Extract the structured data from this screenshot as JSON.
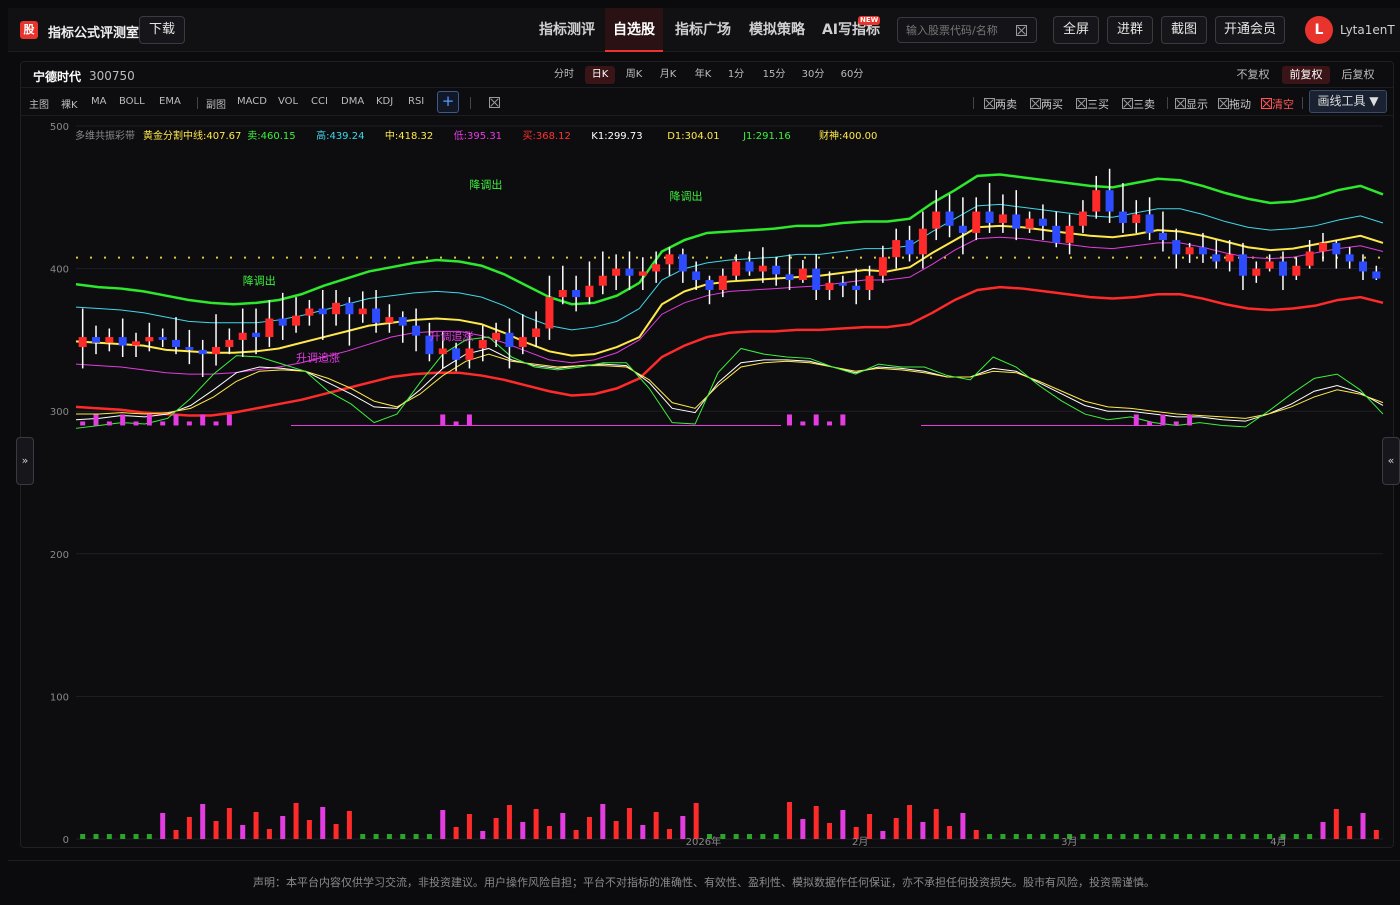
{
  "header": {
    "logo_text": "股",
    "app_title": "指标公式评测室",
    "download_label": "下载",
    "nav": [
      {
        "label": "指标测评"
      },
      {
        "label": "自选股",
        "active": true
      },
      {
        "label": "指标广场"
      },
      {
        "label": "模拟策略"
      },
      {
        "label": "AI写指标",
        "badge": "NEW"
      }
    ],
    "search_placeholder": "输入股票代码/名称",
    "buttons": {
      "fullscreen": "全屏",
      "join_group": "进群",
      "screenshot": "截图",
      "membership": "开通会员"
    },
    "user": {
      "avatar_letter": "L",
      "name": "Lyta1enT"
    }
  },
  "stock": {
    "name": "宁德时代",
    "code": "300750"
  },
  "timeframes": [
    "分时",
    "日K",
    "周K",
    "月K",
    "年K",
    "1分",
    "15分",
    "30分",
    "60分"
  ],
  "active_timeframe": "日K",
  "adjust_options": [
    "不复权",
    "前复权",
    "后复权"
  ],
  "active_adjust": "前复权",
  "indicator_tabs": {
    "main_label": "主图",
    "main": [
      "裸K",
      "MA",
      "BOLL",
      "EMA"
    ],
    "sub_label": "副图",
    "sub": [
      "MACD",
      "VOL",
      "CCI",
      "DMA",
      "KDJ",
      "RSI"
    ],
    "add": "+"
  },
  "toggles": [
    {
      "label": "两卖"
    },
    {
      "label": "两买"
    },
    {
      "label": "三买"
    },
    {
      "label": "三卖"
    },
    {
      "label": "显示"
    },
    {
      "label": "拖动"
    },
    {
      "label": "清空",
      "red": true
    }
  ],
  "draw_tool_label": "画线工具 ▼",
  "chart_data": {
    "type": "candlestick",
    "indicator_name": "多维共振彩带",
    "y_ticks": [
      500,
      400,
      300,
      200,
      100,
      0
    ],
    "ylim": [
      0,
      500
    ],
    "x_labels": [
      "2026年",
      "2月",
      "3月",
      "4月"
    ],
    "legend": [
      {
        "label": "黄金分割中线:407.67",
        "color": "#ffe94a"
      },
      {
        "label": "卖:460.15",
        "color": "#3cf03c"
      },
      {
        "label": "高:439.24",
        "color": "#3fd8e8"
      },
      {
        "label": "中:418.32",
        "color": "#ffe94a"
      },
      {
        "label": "低:395.31",
        "color": "#e33ce0"
      },
      {
        "label": "买:368.12",
        "color": "#ff3030"
      },
      {
        "label": "K1:299.73",
        "color": "#ffffff"
      },
      {
        "label": "D1:304.01",
        "color": "#ffe94a"
      },
      {
        "label": "J1:291.16",
        "color": "#3cf03c"
      },
      {
        "label": "财神:400.00",
        "color": "#ffe94a"
      }
    ],
    "annotations": [
      {
        "label": "降调出",
        "color": "#3cf03c",
        "i": 12,
        "y": 389
      },
      {
        "label": "升调追涨",
        "color": "#e33ce0",
        "i": 16,
        "y": 335
      },
      {
        "label": "升调追涨",
        "color": "#e33ce0",
        "i": 26,
        "y": 350
      },
      {
        "label": "降调出",
        "color": "#3cf03c",
        "i": 29,
        "y": 456
      },
      {
        "label": "降调出",
        "color": "#3cf03c",
        "i": 44,
        "y": 448
      }
    ],
    "golden_line": 407.67,
    "candles": [
      [
        345,
        352,
        330,
        372
      ],
      [
        352,
        348,
        340,
        360
      ],
      [
        348,
        352,
        342,
        358
      ],
      [
        352,
        346,
        338,
        365
      ],
      [
        346,
        349,
        338,
        355
      ],
      [
        349,
        352,
        342,
        362
      ],
      [
        352,
        350,
        345,
        358
      ],
      [
        350,
        345,
        340,
        366
      ],
      [
        345,
        343,
        333,
        357
      ],
      [
        343,
        340,
        324,
        350
      ],
      [
        340,
        345,
        332,
        368
      ],
      [
        345,
        350,
        340,
        358
      ],
      [
        350,
        355,
        338,
        372
      ],
      [
        355,
        352,
        340,
        372
      ],
      [
        352,
        365,
        345,
        378
      ],
      [
        365,
        360,
        350,
        383
      ],
      [
        360,
        367,
        355,
        380
      ],
      [
        367,
        372,
        360,
        378
      ],
      [
        372,
        368,
        350,
        385
      ],
      [
        368,
        376,
        360,
        385
      ],
      [
        376,
        368,
        346,
        380
      ],
      [
        368,
        372,
        362,
        384
      ],
      [
        372,
        362,
        355,
        385
      ],
      [
        362,
        366,
        355,
        375
      ],
      [
        366,
        360,
        348,
        370
      ],
      [
        360,
        353,
        342,
        372
      ],
      [
        353,
        340,
        335,
        362
      ],
      [
        340,
        344,
        330,
        356
      ],
      [
        344,
        336,
        328,
        348
      ],
      [
        336,
        344,
        330,
        355
      ],
      [
        344,
        350,
        335,
        360
      ],
      [
        350,
        355,
        345,
        362
      ],
      [
        355,
        345,
        330,
        365
      ],
      [
        345,
        352,
        340,
        368
      ],
      [
        352,
        358,
        345,
        370
      ],
      [
        358,
        380,
        350,
        395
      ],
      [
        380,
        385,
        375,
        402
      ],
      [
        385,
        380,
        370,
        395
      ],
      [
        380,
        388,
        375,
        405
      ],
      [
        388,
        395,
        382,
        412
      ],
      [
        395,
        400,
        385,
        410
      ],
      [
        400,
        395,
        385,
        412
      ],
      [
        395,
        398,
        385,
        408
      ],
      [
        398,
        403,
        390,
        412
      ],
      [
        403,
        410,
        395,
        415
      ],
      [
        410,
        398,
        390,
        414
      ],
      [
        398,
        392,
        385,
        405
      ],
      [
        392,
        385,
        375,
        395
      ],
      [
        385,
        395,
        380,
        400
      ],
      [
        395,
        405,
        392,
        410
      ],
      [
        405,
        398,
        395,
        412
      ],
      [
        398,
        402,
        390,
        415
      ],
      [
        402,
        396,
        388,
        408
      ],
      [
        396,
        392,
        385,
        410
      ],
      [
        392,
        400,
        390,
        406
      ],
      [
        400,
        385,
        378,
        410
      ],
      [
        385,
        390,
        378,
        398
      ],
      [
        390,
        388,
        380,
        395
      ],
      [
        388,
        385,
        375,
        400
      ],
      [
        385,
        395,
        378,
        402
      ],
      [
        395,
        408,
        390,
        416
      ],
      [
        408,
        420,
        400,
        428
      ],
      [
        420,
        410,
        405,
        430
      ],
      [
        410,
        428,
        400,
        440
      ],
      [
        428,
        440,
        420,
        455
      ],
      [
        440,
        430,
        422,
        452
      ],
      [
        430,
        425,
        410,
        450
      ],
      [
        425,
        440,
        420,
        450
      ],
      [
        440,
        432,
        425,
        460
      ],
      [
        432,
        438,
        425,
        452
      ],
      [
        438,
        428,
        420,
        455
      ],
      [
        428,
        435,
        425,
        440
      ],
      [
        435,
        430,
        420,
        445
      ],
      [
        430,
        418,
        415,
        440
      ],
      [
        418,
        430,
        410,
        438
      ],
      [
        430,
        440,
        425,
        448
      ],
      [
        440,
        455,
        435,
        465
      ],
      [
        455,
        440,
        432,
        470
      ],
      [
        440,
        432,
        425,
        460
      ],
      [
        432,
        438,
        425,
        448
      ],
      [
        438,
        425,
        420,
        450
      ],
      [
        425,
        420,
        412,
        440
      ],
      [
        420,
        410,
        400,
        428
      ],
      [
        410,
        415,
        404,
        418
      ],
      [
        415,
        410,
        404,
        425
      ],
      [
        410,
        405,
        400,
        420
      ],
      [
        405,
        410,
        398,
        420
      ],
      [
        410,
        395,
        385,
        418
      ],
      [
        395,
        400,
        390,
        405
      ],
      [
        400,
        405,
        398,
        410
      ],
      [
        405,
        395,
        385,
        412
      ],
      [
        395,
        402,
        392,
        408
      ],
      [
        402,
        412,
        400,
        420
      ],
      [
        412,
        418,
        405,
        425
      ],
      [
        418,
        410,
        400,
        420
      ],
      [
        410,
        405,
        400,
        415
      ],
      [
        405,
        398,
        392,
        410
      ],
      [
        398,
        393,
        392,
        402
      ]
    ],
    "bands": {
      "sell": [
        389,
        387,
        386,
        384,
        381,
        378,
        376,
        375,
        376,
        378,
        382,
        388,
        393,
        398,
        401,
        404,
        406,
        405,
        402,
        396,
        388,
        380,
        375,
        376,
        381,
        390,
        412,
        420,
        425,
        426,
        427,
        428,
        430,
        430,
        432,
        433,
        433,
        435,
        446,
        455,
        465,
        466,
        464,
        462,
        460,
        458,
        457,
        460,
        463,
        462,
        458,
        453,
        449,
        446,
        447,
        450,
        455,
        458,
        452
      ],
      "high": [
        373,
        372,
        371,
        369,
        366,
        363,
        362,
        362,
        362,
        364,
        367,
        371,
        375,
        379,
        381,
        383,
        384,
        383,
        380,
        374,
        366,
        360,
        357,
        359,
        363,
        372,
        392,
        400,
        404,
        406,
        407,
        408,
        410,
        410,
        412,
        414,
        414,
        416,
        426,
        435,
        444,
        445,
        443,
        441,
        439,
        437,
        436,
        439,
        442,
        442,
        438,
        433,
        429,
        427,
        428,
        430,
        434,
        437,
        432
      ],
      "low": [
        333,
        332,
        331,
        329,
        327,
        326,
        326,
        327,
        329,
        331,
        334,
        338,
        342,
        347,
        352,
        355,
        356,
        356,
        353,
        348,
        342,
        336,
        334,
        336,
        341,
        350,
        368,
        376,
        381,
        384,
        385,
        386,
        387,
        388,
        390,
        392,
        392,
        394,
        403,
        413,
        421,
        422,
        421,
        419,
        417,
        415,
        414,
        416,
        418,
        418,
        415,
        411,
        408,
        407,
        408,
        411,
        414,
        416,
        412
      ],
      "buy": [
        303,
        302,
        301,
        299,
        298,
        297,
        297,
        299,
        302,
        305,
        308,
        312,
        316,
        320,
        324,
        326,
        327,
        327,
        325,
        322,
        318,
        314,
        311,
        312,
        316,
        323,
        338,
        346,
        352,
        355,
        356,
        356,
        357,
        357,
        358,
        359,
        359,
        361,
        369,
        378,
        385,
        387,
        386,
        384,
        382,
        380,
        379,
        380,
        382,
        382,
        379,
        375,
        372,
        371,
        372,
        374,
        378,
        380,
        376
      ],
      "mid": [
        349,
        348,
        347,
        346,
        343,
        342,
        341,
        341,
        342,
        344,
        348,
        352,
        356,
        360,
        362,
        364,
        365,
        364,
        361,
        355,
        348,
        342,
        339,
        340,
        345,
        352,
        375,
        384,
        389,
        391,
        392,
        393,
        394,
        395,
        397,
        399,
        398,
        401,
        411,
        420,
        429,
        430,
        429,
        427,
        425,
        423,
        422,
        424,
        427,
        426,
        423,
        419,
        415,
        413,
        414,
        417,
        420,
        423,
        418
      ]
    },
    "kdj": {
      "k": [
        294,
        295,
        297,
        296,
        298,
        304,
        315,
        327,
        331,
        330,
        328,
        320,
        312,
        303,
        302,
        315,
        330,
        340,
        344,
        336,
        332,
        330,
        332,
        333,
        332,
        320,
        302,
        299,
        320,
        334,
        336,
        336,
        335,
        331,
        327,
        331,
        330,
        328,
        324,
        324,
        330,
        328,
        320,
        312,
        304,
        300,
        300,
        298,
        296,
        296,
        294,
        293,
        298,
        305,
        314,
        318,
        313,
        304
      ],
      "d": [
        298,
        298,
        299,
        298,
        299,
        302,
        310,
        321,
        328,
        329,
        328,
        323,
        316,
        307,
        303,
        312,
        325,
        335,
        340,
        335,
        333,
        331,
        332,
        332,
        331,
        322,
        306,
        302,
        318,
        331,
        334,
        335,
        334,
        331,
        328,
        330,
        329,
        327,
        324,
        324,
        328,
        327,
        321,
        314,
        307,
        303,
        302,
        300,
        298,
        297,
        296,
        295,
        298,
        303,
        310,
        315,
        312,
        306
      ],
      "j": [
        288,
        290,
        292,
        291,
        295,
        309,
        326,
        339,
        338,
        333,
        328,
        314,
        305,
        292,
        298,
        320,
        340,
        350,
        352,
        338,
        331,
        329,
        331,
        334,
        334,
        316,
        292,
        291,
        327,
        344,
        340,
        338,
        337,
        331,
        326,
        333,
        331,
        331,
        325,
        322,
        338,
        331,
        318,
        307,
        298,
        294,
        296,
        292,
        290,
        292,
        290,
        289,
        300,
        312,
        323,
        326,
        315,
        298
      ]
    },
    "vol_dir": [
      0,
      0,
      0,
      0,
      0,
      0,
      1,
      1,
      1,
      1,
      1,
      1,
      1,
      1,
      1,
      1,
      1,
      1,
      1,
      1,
      1,
      0,
      0,
      0,
      0,
      0,
      0,
      1,
      1,
      1,
      1,
      1,
      1,
      1,
      1,
      1,
      1,
      1,
      1,
      1,
      1,
      1,
      1,
      1,
      1,
      1,
      1,
      0,
      0,
      0,
      0,
      0,
      0,
      1,
      1,
      1,
      1,
      1,
      1,
      1,
      1,
      1,
      1,
      1,
      1,
      1,
      1,
      1,
      0,
      0,
      0,
      0,
      0,
      0,
      0,
      0,
      0,
      0,
      0,
      0,
      0,
      0,
      0,
      0,
      0,
      0,
      0,
      0,
      0,
      0,
      0,
      0,
      0,
      1,
      1,
      1,
      1,
      1
    ]
  },
  "left_handle": "»",
  "right_handle": "«",
  "disclaimer": "声明：本平台内容仅供学习交流，非投资建议。用户操作风险自担；平台不对指标的准确性、有效性、盈利性、模拟数据作任何保证，亦不承担任何投资损失。股市有风险，投资需谨慎。"
}
